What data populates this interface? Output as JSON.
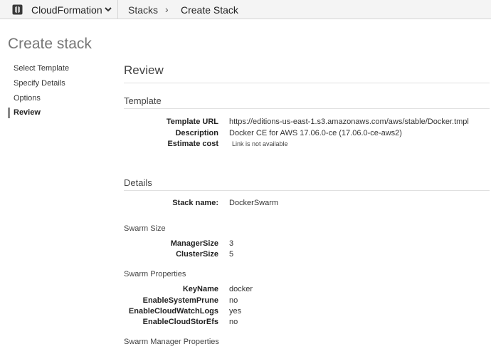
{
  "topbar": {
    "service_name": "CloudFormation",
    "service_icon": "cloudformation-icon",
    "caret_icon": "chevron-down-icon",
    "breadcrumb_stacks": "Stacks",
    "breadcrumb_separator": "›",
    "breadcrumb_current": "Create Stack"
  },
  "page_title": "Create stack",
  "steps": [
    {
      "label": "Select Template",
      "active": false
    },
    {
      "label": "Specify Details",
      "active": false
    },
    {
      "label": "Options",
      "active": false
    },
    {
      "label": "Review",
      "active": true
    }
  ],
  "main": {
    "heading": "Review",
    "template": {
      "heading": "Template",
      "rows": [
        {
          "label": "Template URL",
          "value": "https://editions-us-east-1.s3.amazonaws.com/aws/stable/Docker.tmpl"
        },
        {
          "label": "Description",
          "value": "Docker CE for AWS 17.06.0-ce (17.06.0-ce-aws2)"
        },
        {
          "label": "Estimate cost",
          "value": "Link is not available"
        }
      ]
    },
    "details": {
      "heading": "Details",
      "stack_name_label": "Stack name:",
      "stack_name_value": "DockerSwarm",
      "swarm_size": {
        "heading": "Swarm Size",
        "rows": [
          {
            "label": "ManagerSize",
            "value": "3"
          },
          {
            "label": "ClusterSize",
            "value": "5"
          }
        ]
      },
      "swarm_properties": {
        "heading": "Swarm Properties",
        "rows": [
          {
            "label": "KeyName",
            "value": "docker"
          },
          {
            "label": "EnableSystemPrune",
            "value": "no"
          },
          {
            "label": "EnableCloudWatchLogs",
            "value": "yes"
          },
          {
            "label": "EnableCloudStorEfs",
            "value": "no"
          }
        ]
      },
      "swarm_manager_properties_heading": "Swarm Manager Properties"
    }
  }
}
